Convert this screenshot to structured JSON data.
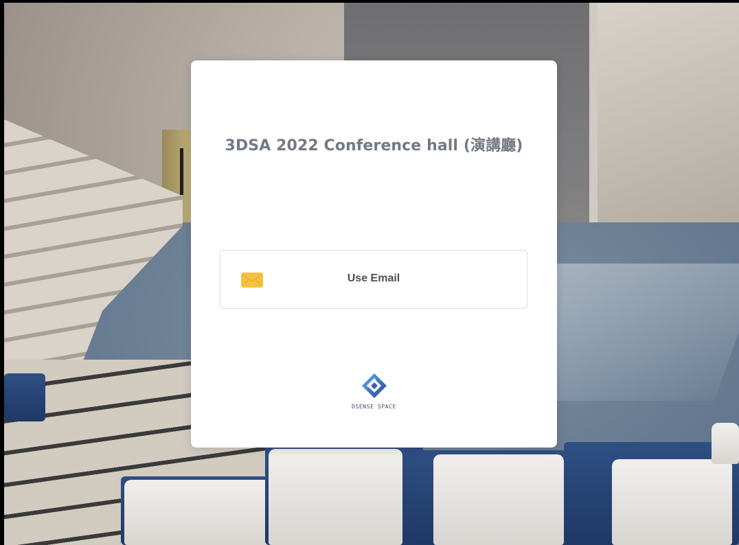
{
  "dialog": {
    "title": "3DSA 2022 Conference hall (演講廳)",
    "email_button": {
      "label": "Use Email",
      "icon": "envelope-icon",
      "icon_color": "#f5c242"
    },
    "brand": {
      "name": "DSENSE SPACE",
      "logo_color_primary": "#5ab4e8",
      "logo_color_secondary": "#2d3d9a"
    }
  },
  "colors": {
    "title_text": "#737a84",
    "button_text": "#4b4f55",
    "button_border": "#d9dbdd",
    "dialog_bg": "#ffffff"
  }
}
